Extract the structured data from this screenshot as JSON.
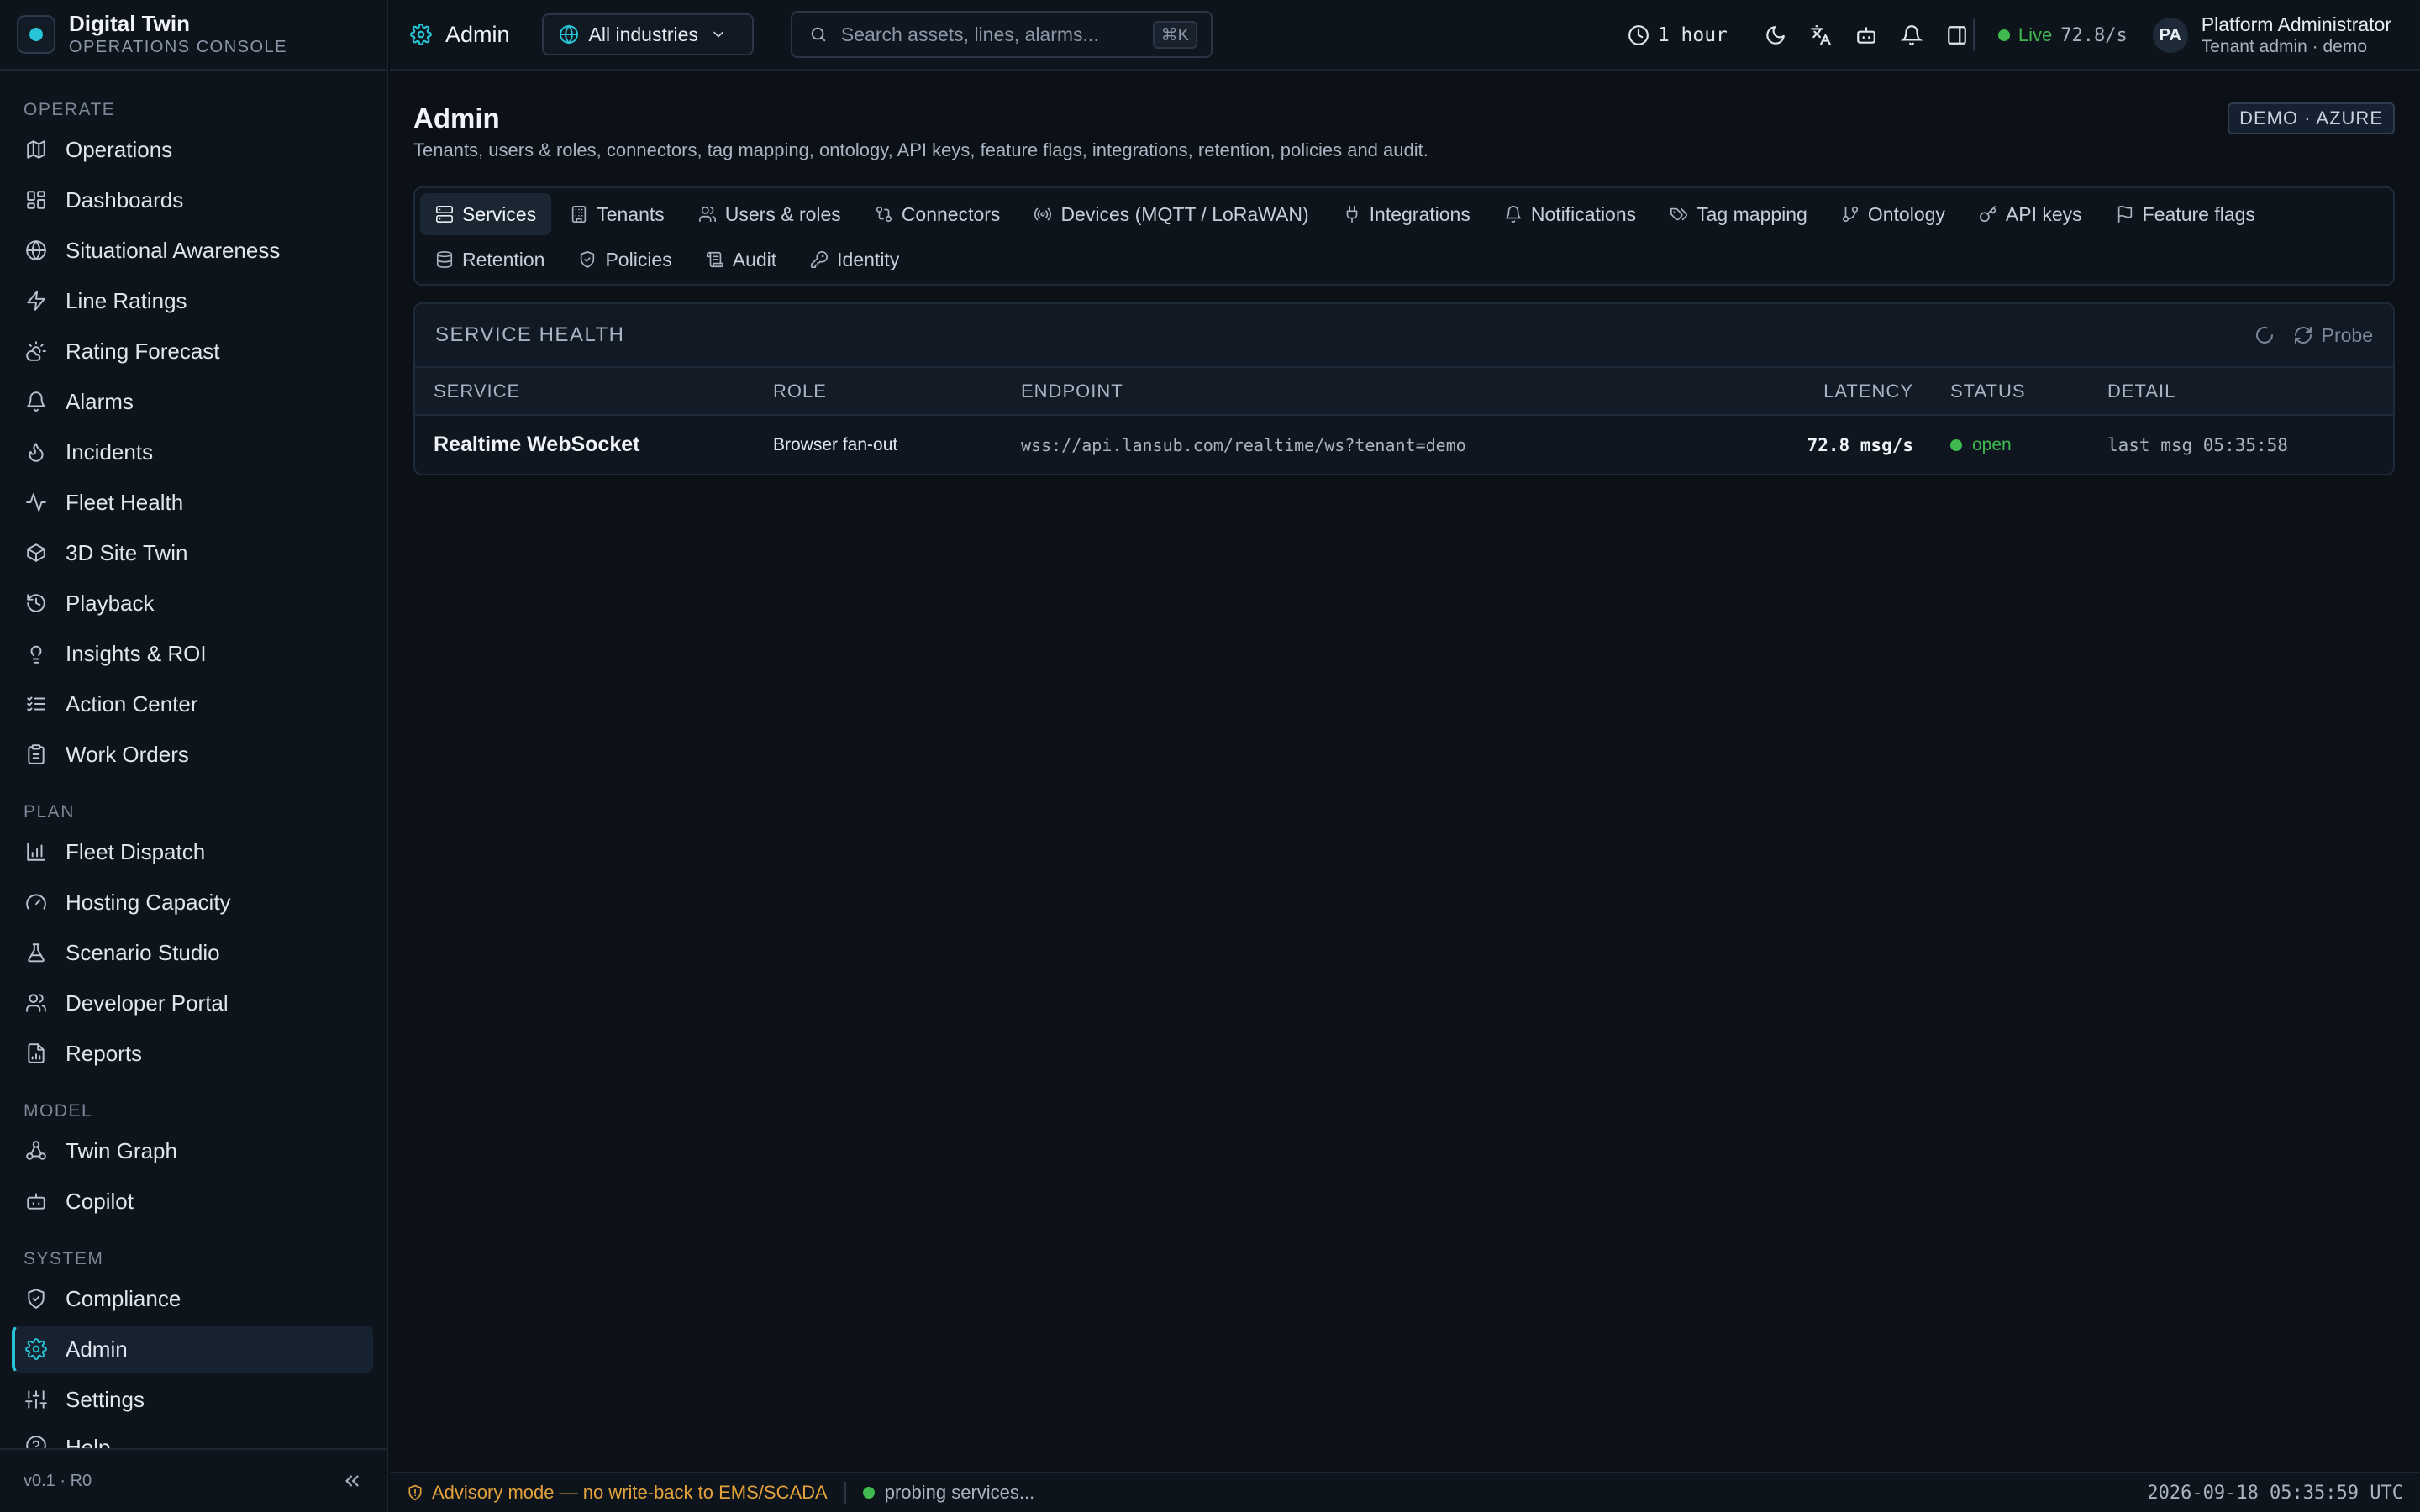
{
  "brand": {
    "title": "Digital Twin",
    "subtitle": "OPERATIONS CONSOLE"
  },
  "sidebar": {
    "sections": [
      {
        "label": "OPERATE",
        "items": [
          {
            "label": "Operations",
            "icon": "map-icon"
          },
          {
            "label": "Dashboards",
            "icon": "dashboard-icon"
          },
          {
            "label": "Situational Awareness",
            "icon": "globe-icon"
          },
          {
            "label": "Line Ratings",
            "icon": "zap-icon"
          },
          {
            "label": "Rating Forecast",
            "icon": "cloud-sun-icon"
          },
          {
            "label": "Alarms",
            "icon": "bell-icon"
          },
          {
            "label": "Incidents",
            "icon": "flame-icon"
          },
          {
            "label": "Fleet Health",
            "icon": "activity-icon"
          },
          {
            "label": "3D Site Twin",
            "icon": "box-icon"
          },
          {
            "label": "Playback",
            "icon": "history-icon"
          },
          {
            "label": "Insights & ROI",
            "icon": "lightbulb-icon"
          },
          {
            "label": "Action Center",
            "icon": "checklist-icon"
          },
          {
            "label": "Work Orders",
            "icon": "clipboard-icon"
          }
        ]
      },
      {
        "label": "PLAN",
        "items": [
          {
            "label": "Fleet Dispatch",
            "icon": "bar-chart-icon"
          },
          {
            "label": "Hosting Capacity",
            "icon": "gauge-icon"
          },
          {
            "label": "Scenario Studio",
            "icon": "flask-icon"
          },
          {
            "label": "Developer Portal",
            "icon": "users-icon"
          },
          {
            "label": "Reports",
            "icon": "file-chart-icon"
          }
        ]
      },
      {
        "label": "MODEL",
        "items": [
          {
            "label": "Twin Graph",
            "icon": "graph-icon"
          },
          {
            "label": "Copilot",
            "icon": "bot-icon"
          }
        ]
      },
      {
        "label": "SYSTEM",
        "items": [
          {
            "label": "Compliance",
            "icon": "shield-check-icon"
          },
          {
            "label": "Admin",
            "icon": "gear-icon",
            "active": true
          },
          {
            "label": "Settings",
            "icon": "sliders-icon"
          },
          {
            "label": "Help",
            "icon": "help-circle-icon",
            "clipped": true
          }
        ]
      }
    ],
    "version": "v0.1 · R0"
  },
  "topbar": {
    "crumb": "Admin",
    "industry": "All industries",
    "search_placeholder": "Search assets, lines, alarms...",
    "search_shortcut": "⌘K",
    "time_range": "1 hour",
    "live_label": "Live",
    "live_rate": "72.8/s",
    "user": {
      "initials": "PA",
      "name": "Platform Administrator",
      "role": "Tenant admin · demo"
    }
  },
  "page": {
    "title": "Admin",
    "description": "Tenants, users & roles, connectors, tag mapping, ontology, API keys, feature flags, integrations, retention, policies and audit.",
    "env_badge": "DEMO · AZURE"
  },
  "tabs": [
    {
      "label": "Services",
      "icon": "server-icon",
      "active": true
    },
    {
      "label": "Tenants",
      "icon": "building-icon"
    },
    {
      "label": "Users & roles",
      "icon": "users-icon"
    },
    {
      "label": "Connectors",
      "icon": "git-compare-icon"
    },
    {
      "label": "Devices (MQTT / LoRaWAN)",
      "icon": "radio-icon"
    },
    {
      "label": "Integrations",
      "icon": "plug-icon"
    },
    {
      "label": "Notifications",
      "icon": "bell-icon"
    },
    {
      "label": "Tag mapping",
      "icon": "tags-icon"
    },
    {
      "label": "Ontology",
      "icon": "git-branch-icon"
    },
    {
      "label": "API keys",
      "icon": "key-icon"
    },
    {
      "label": "Feature flags",
      "icon": "flag-icon"
    },
    {
      "label": "Retention",
      "icon": "database-icon"
    },
    {
      "label": "Policies",
      "icon": "shield-icon"
    },
    {
      "label": "Audit",
      "icon": "scroll-icon"
    },
    {
      "label": "Identity",
      "icon": "key-round-icon"
    }
  ],
  "service_health": {
    "title": "SERVICE HEALTH",
    "probe_label": "Probe",
    "columns": {
      "service": "SERVICE",
      "role": "ROLE",
      "endpoint": "ENDPOINT",
      "latency": "LATENCY",
      "status": "STATUS",
      "detail": "DETAIL"
    },
    "rows": [
      {
        "service": "Realtime WebSocket",
        "role": "Browser fan-out",
        "endpoint": "wss://api.lansub.com/realtime/ws?tenant=demo",
        "latency": "72.8 msg/s",
        "status": "open",
        "detail": "last msg 05:35:58"
      }
    ]
  },
  "statusbar": {
    "advisory": "Advisory mode — no write-back to EMS/SCADA",
    "probing": "probing services...",
    "clock": "2026-09-18 05:35:59 UTC"
  },
  "colors": {
    "accent": "#27c3d6",
    "live": "#3fb950",
    "warning": "#e3a23a"
  }
}
